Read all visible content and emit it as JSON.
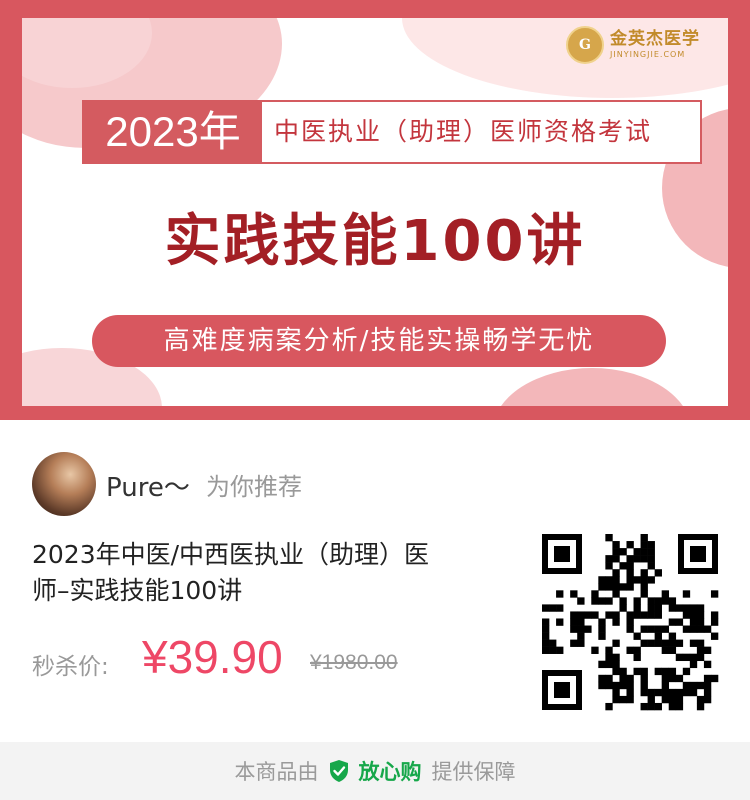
{
  "banner": {
    "logo_name": "金英杰医学",
    "logo_domain": "JINYINGJIE.COM",
    "logo_mark_letter": "G",
    "year": "2023年",
    "exam_name": "中医执业（助理）医师资格考试",
    "main_title": "实践技能100讲",
    "subtitle": "高难度病案分析/技能实操畅学无忧",
    "colors": {
      "frame": "#d8575f",
      "title": "#a31f25",
      "accent": "#d45b60"
    }
  },
  "share": {
    "user_name": "Pure～",
    "recommend_text": "为你推荐"
  },
  "product": {
    "title_line1": "2023年中医/中西医执业（助理）医",
    "title_line2": "师–实践技能100讲",
    "price_label": "秒杀价:",
    "price": "¥39.90",
    "original_price": "¥1980.00",
    "price_color": "#ee4766"
  },
  "footer": {
    "prefix": "本商品由",
    "brand": "放心购",
    "suffix": "提供保障",
    "brand_color": "#16a74a",
    "icon": "shield-check-icon"
  }
}
